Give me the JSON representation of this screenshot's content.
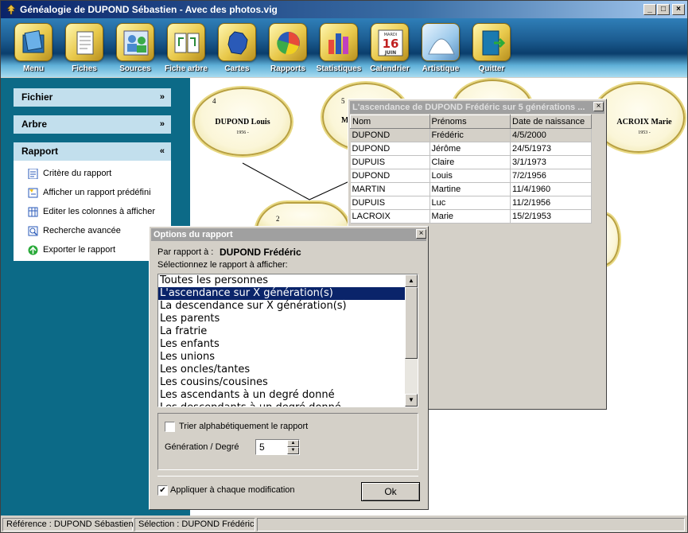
{
  "window": {
    "title": "Généalogie de DUPOND Sébastien - Avec des photos.vig",
    "min": "_",
    "max": "□",
    "close": "×"
  },
  "toolbar": [
    {
      "label": "Menu",
      "icon": "folder-icon"
    },
    {
      "label": "Fiches",
      "icon": "document-icon"
    },
    {
      "label": "Sources",
      "icon": "people-icon"
    },
    {
      "label": "Fiche arbre",
      "icon": "tree-card-icon"
    },
    {
      "label": "Cartes",
      "icon": "map-icon"
    },
    {
      "label": "Rapports",
      "icon": "pie-chart-icon"
    },
    {
      "label": "Statistiques",
      "icon": "bar-chart-icon"
    },
    {
      "label": "Calendrier",
      "icon": "calendar-icon",
      "day": "16",
      "month": "JUIN",
      "weekday": "MARDI"
    },
    {
      "label": "Artistique",
      "icon": "arch-icon"
    },
    {
      "label": "Quitter",
      "icon": "exit-door-icon"
    }
  ],
  "sidebar": {
    "fichier": {
      "label": "Fichier",
      "chevron": "»"
    },
    "arbre": {
      "label": "Arbre",
      "chevron": "»"
    },
    "rapport": {
      "label": "Rapport",
      "chevron": "«"
    },
    "items": [
      {
        "label": "Critère du rapport",
        "icon": "criteria-icon"
      },
      {
        "label": "Afficher un rapport prédéfini",
        "icon": "predefined-report-icon"
      },
      {
        "label": "Editer les colonnes à afficher",
        "icon": "columns-icon"
      },
      {
        "label": "Recherche avancée",
        "icon": "advanced-search-icon"
      },
      {
        "label": "Exporter le rapport",
        "icon": "export-icon"
      }
    ]
  },
  "tree": {
    "n4": {
      "num": "4",
      "name": "DUPOND Louis",
      "years": "1956 -"
    },
    "n5": {
      "num": "5",
      "name": "M"
    },
    "n7": {
      "name": "ACROIX Marie",
      "years": "1953 -"
    },
    "n2": {
      "num": "2"
    }
  },
  "ascendance": {
    "title": "L'ascendance de DUPOND Frédéric sur 5 générations ...",
    "close": "×",
    "columns": [
      "Nom",
      "Prénoms",
      "Date de naissance"
    ],
    "rows": [
      [
        "DUPOND",
        "Frédéric",
        "4/5/2000"
      ],
      [
        "DUPOND",
        "Jérôme",
        "24/5/1973"
      ],
      [
        "DUPUIS",
        "Claire",
        "3/1/1973"
      ],
      [
        "DUPOND",
        "Louis",
        "7/2/1956"
      ],
      [
        "MARTIN",
        "Martine",
        "11/4/1960"
      ],
      [
        "DUPUIS",
        "Luc",
        "11/2/1956"
      ],
      [
        "LACROIX",
        "Marie",
        "15/2/1953"
      ]
    ]
  },
  "options": {
    "title": "Options du rapport",
    "close": "×",
    "par_rapport_label": "Par rapport à :",
    "par_rapport_value": "DUPOND Frédéric",
    "select_label": "Sélectionnez le rapport à afficher:",
    "reports": [
      "Toutes les personnes",
      "L'ascendance sur X génération(s)",
      "La descendance sur X génération(s)",
      "Les parents",
      "La fratrie",
      "Les enfants",
      "Les unions",
      "Les oncles/tantes",
      "Les cousins/cousines",
      "Les ascendants à un degré donné",
      "Les descendants à un degré donné"
    ],
    "selected_index": 1,
    "sort_label": "Trier alphabétiquement le rapport",
    "sort_checked": false,
    "generation_label": "Génération / Degré",
    "generation_value": "5",
    "apply_label": "Appliquer à chaque modification",
    "apply_checked": true,
    "apply_mark": "✔",
    "ok_label": "Ok"
  },
  "status": {
    "reference": "Référence : DUPOND Sébastien",
    "selection": "Sélection : DUPOND Frédéric"
  }
}
